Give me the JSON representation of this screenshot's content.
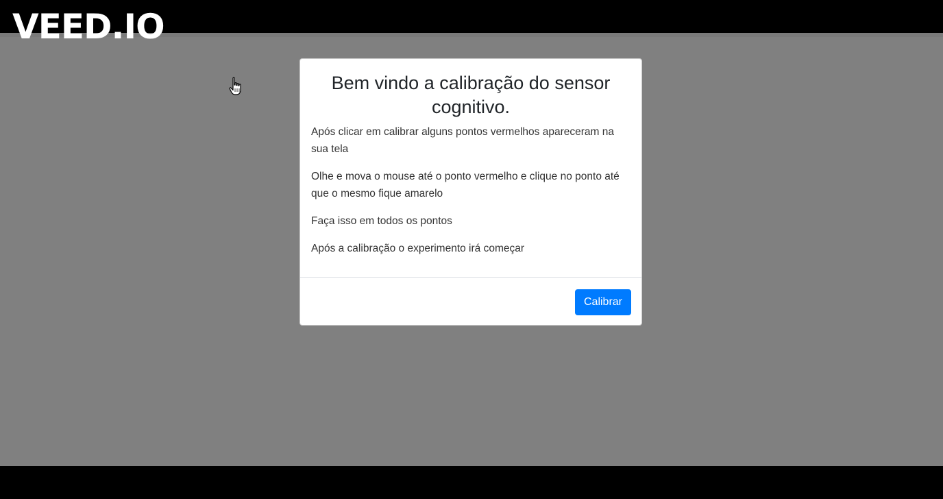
{
  "watermark": "VEED.IO",
  "modal": {
    "title": "Bem vindo a calibração do sensor cognitivo.",
    "paragraphs": [
      "Após clicar em calibrar alguns pontos vermelhos apareceram na sua tela",
      "Olhe e mova o mouse até o ponto vermelho e clique no ponto até que o mesmo fique amarelo",
      "Faça isso em todos os pontos",
      "Após a calibração o experimento irá começar"
    ],
    "button_label": "Calibrar"
  },
  "colors": {
    "backdrop": "#808080",
    "letterbox": "#000000",
    "button": "#007bff"
  },
  "cursor_icon": "hand-pointer-icon"
}
